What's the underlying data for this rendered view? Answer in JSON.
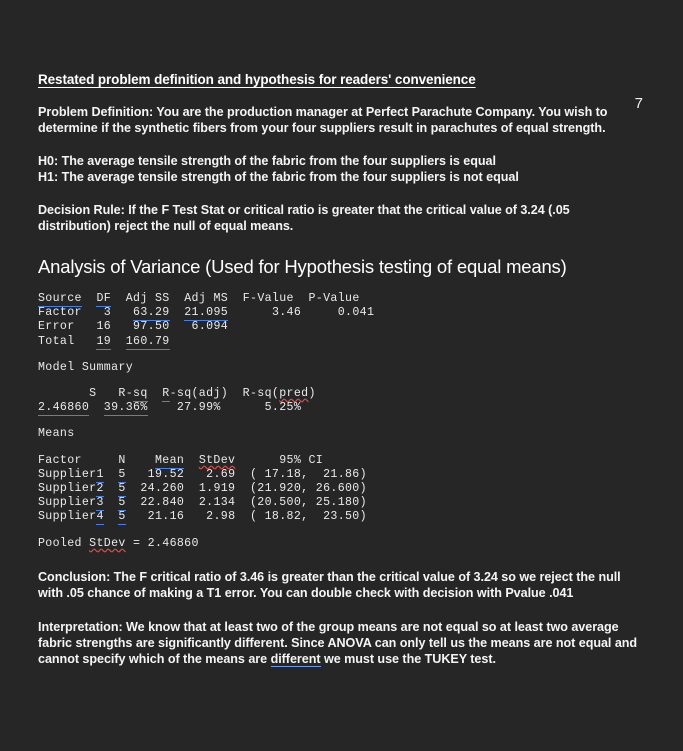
{
  "page": {
    "number": "7",
    "background_color": "#262626",
    "text_color": "#f2f2f2",
    "grammar_underline_color": "#4a7fe8",
    "spelling_underline_color": "#e04b4b"
  },
  "heading": "Restated problem definition and hypothesis for readers' convenience",
  "problem": {
    "label": "Problem Definition:",
    "text": " You are the production manager at Perfect Parachute Company. You wish to determine if the synthetic fibers from your four suppliers result in parachutes of equal strength."
  },
  "hypotheses": {
    "h0": "H0: The average tensile strength of the fabric from the four suppliers is equal",
    "h1": "H1: The average tensile strength of the fabric from the four suppliers is not equal"
  },
  "decision_rule": {
    "text": "Decision Rule: If the F Test Stat or critical ratio is greater that the critical value of 3.24 (.05 distribution) reject the null of equal means."
  },
  "anova_section_title": "Analysis of Variance (Used for Hypothesis testing of equal means)",
  "anova": {
    "headers": [
      "Source",
      "DF",
      "Adj SS",
      "Adj MS",
      "F-Value",
      "P-Value"
    ],
    "rows": [
      {
        "source": "Factor",
        "df": "3",
        "adj_ss": "63.29",
        "adj_ms": "21.095",
        "f_value": "3.46",
        "p_value": "0.041"
      },
      {
        "source": "Error",
        "df": "16",
        "adj_ss": "97.50",
        "adj_ms": "6.094",
        "f_value": "",
        "p_value": ""
      },
      {
        "source": "Total",
        "df": "19",
        "adj_ss": "160.79",
        "adj_ms": "",
        "f_value": "",
        "p_value": ""
      }
    ]
  },
  "model_summary": {
    "title": "Model Summary",
    "headers": [
      "S",
      "R-sq",
      "R-sq(adj)",
      "R-sq(pred)"
    ],
    "values": [
      "2.46860",
      "39.36%",
      "27.99%",
      "5.25%"
    ]
  },
  "means": {
    "title": "Means",
    "headers": [
      "Factor",
      "N",
      "Mean",
      "StDev",
      "95% CI"
    ],
    "rows": [
      {
        "factor": "Supplier1",
        "n": "5",
        "mean": "19.52",
        "stdev": "2.69",
        "ci": "( 17.18,  21.86)"
      },
      {
        "factor": "Supplier2",
        "n": "5",
        "mean": "24.260",
        "stdev": "1.919",
        "ci": "(21.920, 26.600)"
      },
      {
        "factor": "Supplier3",
        "n": "5",
        "mean": "22.840",
        "stdev": "2.134",
        "ci": "(20.500, 25.180)"
      },
      {
        "factor": "Supplier4",
        "n": "5",
        "mean": "21.16",
        "stdev": "2.98",
        "ci": "( 18.82,  23.50)"
      }
    ],
    "pooled_stdev_label": "Pooled StDev",
    "pooled_stdev_value": "2.46860"
  },
  "conclusion": {
    "label": "Conclusion:",
    "text": " The F critical ratio of 3.46 is greater than the critical value of 3.24 so we reject the null with .05 chance of making a T1 error. You can double check with decision with Pvalue .041"
  },
  "interpretation": {
    "label": "Interpretation",
    "text_1": ": We know that at least two of the group means are not equal so at least two average fabric strengths are significantly different. Since ANOVA can only tell us the means are not equal and cannot specify which of the means are ",
    "flagged_word": "different",
    "text_2": " we must use the ",
    "bold_tail": "TUKEY test.",
    "text_3": ""
  }
}
